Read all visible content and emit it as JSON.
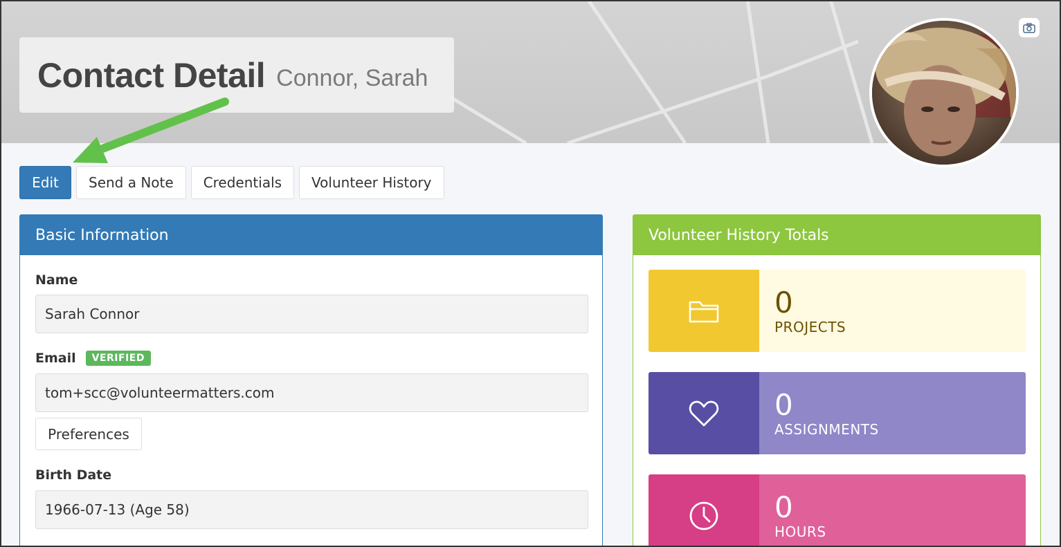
{
  "header": {
    "title": "Contact Detail",
    "subtitle": "Connor, Sarah"
  },
  "tabs": [
    {
      "label": "Edit"
    },
    {
      "label": "Send a Note"
    },
    {
      "label": "Credentials"
    },
    {
      "label": "Volunteer History"
    }
  ],
  "basic_info": {
    "heading": "Basic Information",
    "name_label": "Name",
    "name_value": "Sarah Connor",
    "email_label": "Email",
    "email_badge": "VERIFIED",
    "email_value": "tom+scc@volunteermatters.com",
    "preferences_label": "Preferences",
    "birth_label": "Birth Date",
    "birth_value": "1966-07-13 (Age 58)"
  },
  "totals": {
    "heading": "Volunteer History Totals",
    "stats": [
      {
        "value": "0",
        "label": "PROJECTS",
        "icon": "folder-icon"
      },
      {
        "value": "0",
        "label": "ASSIGNMENTS",
        "icon": "heart-icon"
      },
      {
        "value": "0",
        "label": "HOURS",
        "icon": "clock-icon"
      }
    ]
  },
  "colors": {
    "primary": "#337ab7",
    "green": "#8dc63f",
    "badge_green": "#5cb85c",
    "projects_dark": "#f2c830",
    "projects_light": "#fffae2",
    "assignments_dark": "#584ea3",
    "assignments_light": "#8f87c8",
    "hours_dark": "#d63e86",
    "hours_light": "#e0609a",
    "arrow": "#62c14a"
  }
}
